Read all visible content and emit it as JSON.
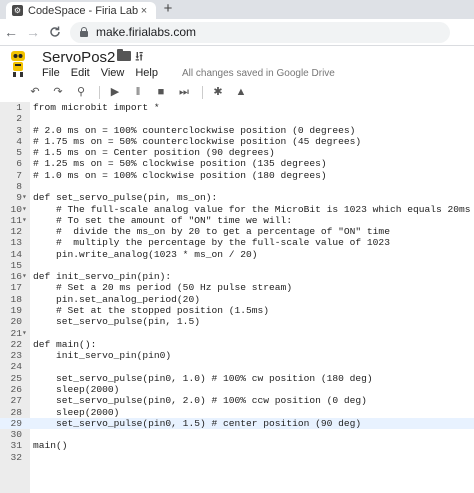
{
  "browser": {
    "tab_title": "CodeSpace - Firia Labs",
    "tab_close": "×",
    "new_tab": "+",
    "back": "←",
    "forward": "→",
    "reload": "C",
    "url": "make.firialabs.com"
  },
  "app": {
    "project_title": "ServoPos2",
    "menu": [
      "File",
      "Edit",
      "View",
      "Help"
    ],
    "save_status": "All changes saved in Google Drive"
  },
  "toolbar": {
    "undo": "↶",
    "redo": "↷",
    "search": "⚲",
    "play": "▶",
    "pause": "‖",
    "stop": "■",
    "step_end": "⏭",
    "debug": "✱",
    "learn": "▲"
  },
  "editor": {
    "active_line": 29,
    "lines": [
      "from microbit import *",
      "",
      "# 2.0 ms on = 100% counterclockwise position (0 degrees)",
      "# 1.75 ms on = 50% counterclockwise position (45 degrees)",
      "# 1.5 ms on = Center position (90 degrees)",
      "# 1.25 ms on = 50% clockwise position (135 degrees)",
      "# 1.0 ms on = 100% clockwise position (180 degrees)",
      "",
      "def set_servo_pulse(pin, ms_on):",
      "    # The full-scale analog value for the MicroBit is 1023 which equals 20ms",
      "    # To set the amount of \"ON\" time we will:",
      "    #  divide the ms_on by 20 to get a percentage of \"ON\" time",
      "    #  multiply the percentage by the full-scale value of 1023",
      "    pin.write_analog(1023 * ms_on / 20)",
      "",
      "def init_servo_pin(pin):",
      "    # Set a 20 ms period (50 Hz pulse stream)",
      "    pin.set_analog_period(20)",
      "    # Set at the stopped position (1.5ms)",
      "    set_servo_pulse(pin, 1.5)",
      "",
      "def main():",
      "    init_servo_pin(pin0)",
      "",
      "    set_servo_pulse(pin0, 1.0) # 100% cw position (180 deg)",
      "    sleep(2000)",
      "    set_servo_pulse(pin0, 2.0) # 100% ccw position (0 deg)",
      "    sleep(2000)",
      "    set_servo_pulse(pin0, 1.5) # center position (90 deg)",
      "",
      "main()",
      ""
    ],
    "fold_lines": [
      9,
      10,
      11,
      16,
      21
    ]
  }
}
